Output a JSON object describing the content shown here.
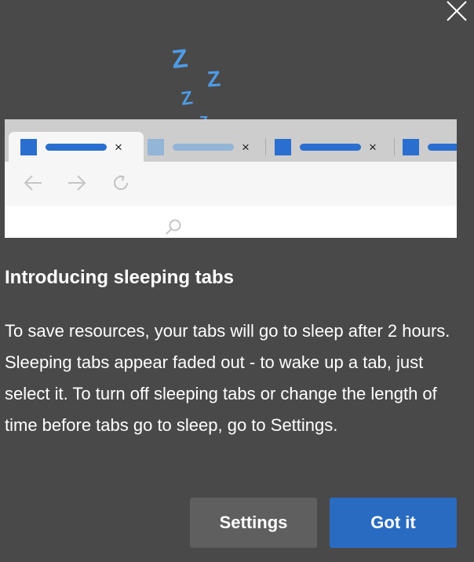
{
  "dialog": {
    "close_icon": "close-icon",
    "zzz": [
      "Z",
      "Z",
      "Z",
      "Z"
    ],
    "heading": "Introducing sleeping tabs",
    "body": "To save resources, your tabs will go to sleep after 2 hours. Sleeping tabs appear faded out - to wake up a tab, just select it. To turn off sleeping tabs or change the length of time before tabs go to sleep, go to Settings.",
    "buttons": {
      "settings": "Settings",
      "got_it": "Got it"
    }
  },
  "illustration": {
    "tabs": [
      {
        "state": "active",
        "close": "×"
      },
      {
        "state": "sleeping",
        "close": "×"
      },
      {
        "state": "normal",
        "close": "×"
      },
      {
        "state": "normal-cut-off"
      }
    ],
    "nav_icons": [
      "back-arrow-icon",
      "forward-arrow-icon",
      "refresh-icon",
      "search-icon"
    ]
  },
  "colors": {
    "background": "#494949",
    "accent_blue": "#2a6bc2",
    "favicon_blue": "#2a6fcf",
    "sleeping_blue": "#93b5d6",
    "zzz_blue": "#4f9be6",
    "settings_button": "#5f5f5f"
  }
}
